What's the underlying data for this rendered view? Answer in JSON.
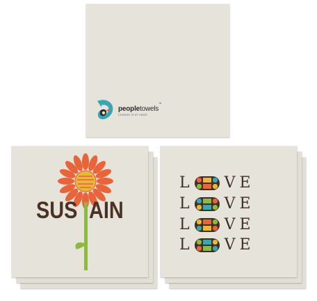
{
  "top_card": {
    "logo": {
      "brand_bold": "people",
      "brand_thin": "towels",
      "trademark": "™",
      "tagline": "CHANGE IS AT HAND",
      "colors": {
        "teal": "#3aa7b0",
        "dark": "#2b2b2b",
        "orange": "#e8643a",
        "cream": "#f0e7c8"
      }
    }
  },
  "sustain_card": {
    "word_left": "SUS",
    "word_right": "AIN",
    "colors": {
      "petal": "#e8643a",
      "center": "#e9b73a",
      "stem": "#8cba3e",
      "text": "#4a3324"
    }
  },
  "love_card": {
    "rows": [
      {
        "l": "L",
        "rest": "VE"
      },
      {
        "l": "L",
        "rest": "VE"
      },
      {
        "l": "L",
        "rest": "VE"
      },
      {
        "l": "L",
        "rest": "VE"
      }
    ],
    "colors": {
      "text": "#3e2e24",
      "orange": "#e8643a",
      "yellow": "#e9b73a",
      "teal": "#3aa7b0",
      "green": "#8cba3e"
    }
  }
}
